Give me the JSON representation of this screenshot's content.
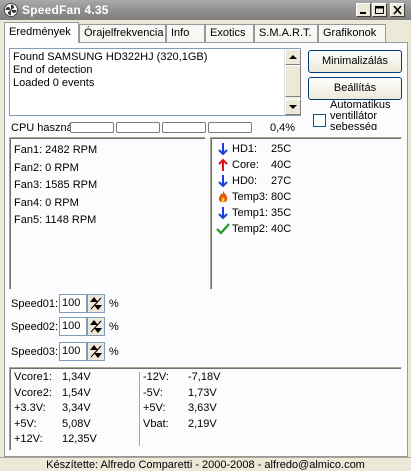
{
  "window": {
    "title": "SpeedFan 4.35",
    "icon": "fan-icon"
  },
  "tabs": [
    {
      "label": "Eredmények",
      "active": true
    },
    {
      "label": "Órajelfrekvencia",
      "active": false
    },
    {
      "label": "Info",
      "active": false
    },
    {
      "label": "Exotics",
      "active": false
    },
    {
      "label": "S.M.A.R.T.",
      "active": false
    },
    {
      "label": "Grafikonok",
      "active": false
    }
  ],
  "log": {
    "lines": [
      "Found SAMSUNG HD322HJ (320,1GB)",
      "End of detection",
      "Loaded 0 events"
    ]
  },
  "buttons": {
    "minimize": "Minimalizálás",
    "settings": "Beállítás"
  },
  "auto_fan": {
    "label": "Automatikus ventillátor sebesség",
    "checked": false
  },
  "cpu": {
    "label": "CPU haszná",
    "percent_text": "0,4%",
    "usage": 0.004
  },
  "fans": [
    "Fan1: 2482 RPM",
    "Fan2: 0 RPM",
    "Fan3: 1585 RPM",
    "Fan4: 0 RPM",
    "Fan5: 1148 RPM"
  ],
  "temps": [
    {
      "name": "HD1:",
      "value": "25C",
      "icon": "arrow-down-icon",
      "color": "#1a3fd6"
    },
    {
      "name": "Core:",
      "value": "40C",
      "icon": "arrow-up-icon",
      "color": "#e01010"
    },
    {
      "name": "HD0:",
      "value": "27C",
      "icon": "arrow-down-icon",
      "color": "#1a3fd6"
    },
    {
      "name": "Temp3:",
      "value": "80C",
      "icon": "flame-icon",
      "color": "#e05a00"
    },
    {
      "name": "Temp1:",
      "value": "35C",
      "icon": "arrow-down-icon",
      "color": "#1a3fd6"
    },
    {
      "name": "Temp2:",
      "value": "40C",
      "icon": "checkmark-icon",
      "color": "#1f9a2a"
    }
  ],
  "speeds": [
    {
      "label": "Speed01:",
      "value": "100",
      "unit": "%"
    },
    {
      "label": "Speed02:",
      "value": "100",
      "unit": "%"
    },
    {
      "label": "Speed03:",
      "value": "100",
      "unit": "%"
    }
  ],
  "voltages_left": [
    {
      "name": "Vcore1:",
      "value": "1,34V"
    },
    {
      "name": "Vcore2:",
      "value": "1,54V"
    },
    {
      "name": "+3.3V:",
      "value": "3,34V"
    },
    {
      "name": "+5V:",
      "value": "5,08V"
    },
    {
      "name": "+12V:",
      "value": "12,35V"
    }
  ],
  "voltages_right": [
    {
      "name": "-12V:",
      "value": "-7,18V"
    },
    {
      "name": "-5V:",
      "value": "1,73V"
    },
    {
      "name": "+5V:",
      "value": "3,63V"
    },
    {
      "name": "Vbat:",
      "value": "2,19V"
    }
  ],
  "status": "Készítette: Alfredo Comparetti - 2000-2008 - alfredo@almico.com"
}
